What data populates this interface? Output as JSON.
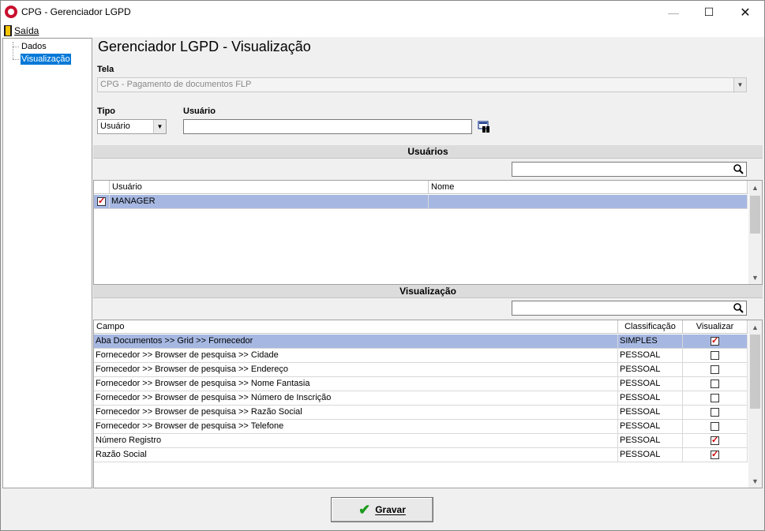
{
  "window": {
    "title": "CPG - Gerenciador LGPD"
  },
  "menu": {
    "exit_label": "Saída"
  },
  "tree": {
    "items": [
      {
        "label": "Dados"
      },
      {
        "label": "Visualização"
      }
    ]
  },
  "main": {
    "title": "Gerenciador LGPD - Visualização",
    "tela": {
      "label": "Tela",
      "value": "CPG - Pagamento de documentos FLP"
    },
    "tipo": {
      "label": "Tipo",
      "value": "Usuário"
    },
    "usuario": {
      "label": "Usuário",
      "value": ""
    }
  },
  "users_section": {
    "header": "Usuários",
    "search_value": "",
    "columns": [
      "Usuário",
      "Nome"
    ],
    "rows": [
      {
        "checked": true,
        "usuario": "MANAGER",
        "nome": ""
      }
    ]
  },
  "view_section": {
    "header": "Visualização",
    "search_value": "",
    "columns": [
      "Campo",
      "Classificação",
      "Visualizar"
    ],
    "rows": [
      {
        "campo": "Aba Documentos >> Grid >> Fornecedor",
        "classificacao": "SIMPLES",
        "visualizar": true
      },
      {
        "campo": "Fornecedor >> Browser de pesquisa >> Cidade",
        "classificacao": "PESSOAL",
        "visualizar": false
      },
      {
        "campo": "Fornecedor >> Browser de pesquisa >> Endereço",
        "classificacao": "PESSOAL",
        "visualizar": false
      },
      {
        "campo": "Fornecedor >> Browser de pesquisa >> Nome Fantasia",
        "classificacao": "PESSOAL",
        "visualizar": false
      },
      {
        "campo": "Fornecedor >> Browser de pesquisa >> Número de Inscrição",
        "classificacao": "PESSOAL",
        "visualizar": false
      },
      {
        "campo": "Fornecedor >> Browser de pesquisa >> Razão Social",
        "classificacao": "PESSOAL",
        "visualizar": false
      },
      {
        "campo": "Fornecedor >> Browser de pesquisa >> Telefone",
        "classificacao": "PESSOAL",
        "visualizar": false
      },
      {
        "campo": "Número Registro",
        "classificacao": "PESSOAL",
        "visualizar": true
      },
      {
        "campo": "Razão Social",
        "classificacao": "PESSOAL",
        "visualizar": true
      }
    ]
  },
  "actions": {
    "save_label": "Gravar"
  },
  "colors": {
    "selection": "#a6b8e2",
    "tree_selection": "#0078d7",
    "check_mark": "#d00000",
    "brand": "#c8102e"
  }
}
